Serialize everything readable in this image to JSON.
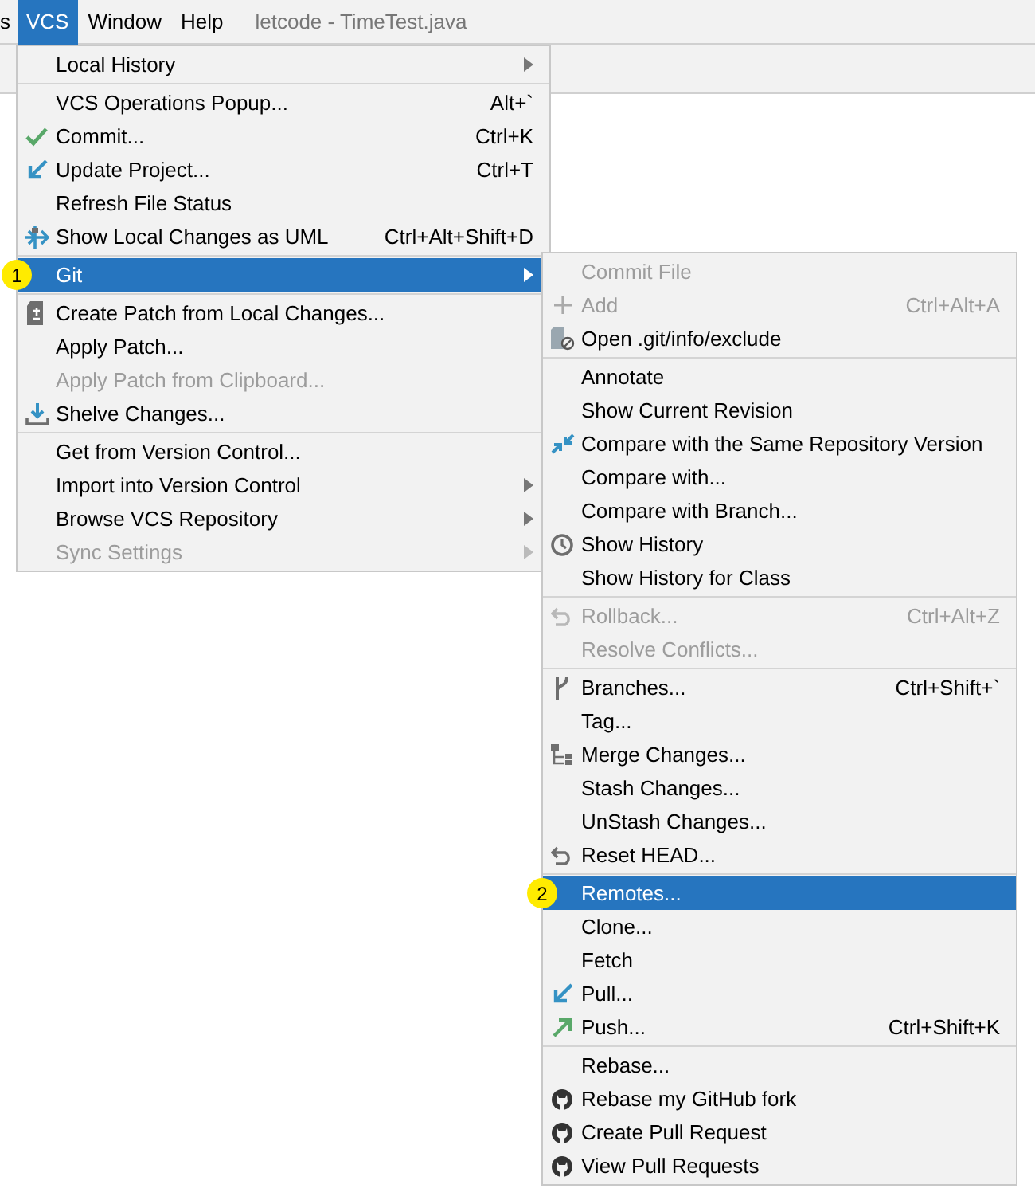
{
  "menu_bar": {
    "items": [
      {
        "label": "s",
        "selected": false
      },
      {
        "label": "VCS",
        "selected": true
      },
      {
        "label": "Window",
        "selected": false
      },
      {
        "label": "Help",
        "selected": false
      }
    ],
    "title": "letcode - TimeTest.java"
  },
  "vcs_menu": {
    "groups": [
      [
        {
          "label": "Local History",
          "has_submenu": true,
          "selected": false,
          "disabled": false
        }
      ],
      [
        {
          "label": "VCS Operations Popup...",
          "shortcut": "Alt+`",
          "has_submenu": false,
          "selected": false,
          "disabled": false
        },
        {
          "label": "Commit...",
          "shortcut": "Ctrl+K",
          "has_submenu": false,
          "selected": false,
          "disabled": false
        },
        {
          "label": "Update Project...",
          "shortcut": "Ctrl+T",
          "has_submenu": false,
          "selected": false,
          "disabled": false
        },
        {
          "label": "Refresh File Status",
          "has_submenu": false,
          "selected": false,
          "disabled": false
        },
        {
          "label": "Show Local Changes as UML",
          "shortcut": "Ctrl+Alt+Shift+D",
          "has_submenu": false,
          "selected": false,
          "disabled": false
        }
      ],
      [
        {
          "label": "Git",
          "has_submenu": true,
          "selected": true,
          "disabled": false,
          "badge": "1"
        }
      ],
      [
        {
          "label": "Create Patch from Local Changes...",
          "has_submenu": false,
          "selected": false,
          "disabled": false
        },
        {
          "label": "Apply Patch...",
          "has_submenu": false,
          "selected": false,
          "disabled": false
        },
        {
          "label": "Apply Patch from Clipboard...",
          "has_submenu": false,
          "selected": false,
          "disabled": true
        },
        {
          "label": "Shelve Changes...",
          "has_submenu": false,
          "selected": false,
          "disabled": false
        }
      ],
      [
        {
          "label": "Get from Version Control...",
          "has_submenu": false,
          "selected": false,
          "disabled": false
        },
        {
          "label": "Import into Version Control",
          "has_submenu": true,
          "selected": false,
          "disabled": false
        },
        {
          "label": "Browse VCS Repository",
          "has_submenu": true,
          "selected": false,
          "disabled": false
        },
        {
          "label": "Sync Settings",
          "has_submenu": true,
          "selected": false,
          "disabled": true
        }
      ]
    ]
  },
  "git_menu": {
    "groups": [
      [
        {
          "label": "Commit File",
          "has_submenu": false,
          "selected": false,
          "disabled": true
        },
        {
          "label": "Add",
          "shortcut": "Ctrl+Alt+A",
          "has_submenu": false,
          "selected": false,
          "disabled": true
        },
        {
          "label": "Open .git/info/exclude",
          "has_submenu": false,
          "selected": false,
          "disabled": false
        }
      ],
      [
        {
          "label": "Annotate",
          "has_submenu": false,
          "selected": false,
          "disabled": false
        },
        {
          "label": "Show Current Revision",
          "has_submenu": false,
          "selected": false,
          "disabled": false
        },
        {
          "label": "Compare with the Same Repository Version",
          "has_submenu": false,
          "selected": false,
          "disabled": false
        },
        {
          "label": "Compare with...",
          "has_submenu": false,
          "selected": false,
          "disabled": false
        },
        {
          "label": "Compare with Branch...",
          "has_submenu": false,
          "selected": false,
          "disabled": false
        },
        {
          "label": "Show History",
          "has_submenu": false,
          "selected": false,
          "disabled": false
        },
        {
          "label": "Show History for Class",
          "has_submenu": false,
          "selected": false,
          "disabled": false
        }
      ],
      [
        {
          "label": "Rollback...",
          "shortcut": "Ctrl+Alt+Z",
          "has_submenu": false,
          "selected": false,
          "disabled": true
        },
        {
          "label": "Resolve Conflicts...",
          "has_submenu": false,
          "selected": false,
          "disabled": true
        }
      ],
      [
        {
          "label": "Branches...",
          "shortcut": "Ctrl+Shift+`",
          "has_submenu": false,
          "selected": false,
          "disabled": false
        },
        {
          "label": "Tag...",
          "has_submenu": false,
          "selected": false,
          "disabled": false
        },
        {
          "label": "Merge Changes...",
          "has_submenu": false,
          "selected": false,
          "disabled": false
        },
        {
          "label": "Stash Changes...",
          "has_submenu": false,
          "selected": false,
          "disabled": false
        },
        {
          "label": "UnStash Changes...",
          "has_submenu": false,
          "selected": false,
          "disabled": false
        },
        {
          "label": "Reset HEAD...",
          "has_submenu": false,
          "selected": false,
          "disabled": false
        }
      ],
      [
        {
          "label": "Remotes...",
          "has_submenu": false,
          "selected": true,
          "disabled": false,
          "badge": "2"
        },
        {
          "label": "Clone...",
          "has_submenu": false,
          "selected": false,
          "disabled": false
        },
        {
          "label": "Fetch",
          "has_submenu": false,
          "selected": false,
          "disabled": false
        },
        {
          "label": "Pull...",
          "has_submenu": false,
          "selected": false,
          "disabled": false
        },
        {
          "label": "Push...",
          "shortcut": "Ctrl+Shift+K",
          "has_submenu": false,
          "selected": false,
          "disabled": false
        }
      ],
      [
        {
          "label": "Rebase...",
          "has_submenu": false,
          "selected": false,
          "disabled": false
        },
        {
          "label": "Rebase my GitHub fork",
          "has_submenu": false,
          "selected": false,
          "disabled": false
        },
        {
          "label": "Create Pull Request",
          "has_submenu": false,
          "selected": false,
          "disabled": false
        },
        {
          "label": "View Pull Requests",
          "has_submenu": false,
          "selected": false,
          "disabled": false
        }
      ]
    ]
  }
}
